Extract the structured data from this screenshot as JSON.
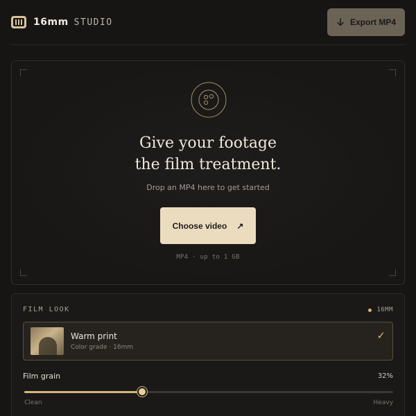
{
  "header": {
    "brand_name": "16mm",
    "brand_sub": "STUDIO",
    "export_label": "Export MP4"
  },
  "upload": {
    "headline_line1": "Give your footage",
    "headline_line2": "the film treatment.",
    "subtext": "Drop an MP4 here to get started",
    "button_label": "Choose video",
    "button_arrow": "↗",
    "limit_text": "MP4 · up to 1 GB"
  },
  "film_look": {
    "label": "FILM LOOK",
    "tag": "16MM",
    "preset": {
      "title": "Warm print",
      "subtitle": "Color grade · 16mm",
      "selected_mark": "✓"
    },
    "grain": {
      "label": "Film grain",
      "value_text": "32%",
      "value": 0.32,
      "min_label": "Clean",
      "max_label": "Heavy"
    }
  },
  "colors": {
    "accent": "#d6b67c",
    "primary_button": "#ebdcc0",
    "background": "#161514"
  },
  "icons": {
    "brand": "film-strip-icon",
    "export": "arrow-down-icon",
    "upload": "film-reel-icon",
    "selected": "check-icon"
  }
}
